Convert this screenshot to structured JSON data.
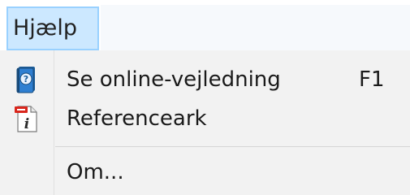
{
  "menubar": {
    "title": "Hjælp"
  },
  "menu": {
    "items": [
      {
        "label": "Se online-vejledning",
        "shortcut": "F1",
        "icon": "help-book-icon"
      },
      {
        "label": "Referenceark",
        "icon": "pdf-info-document-icon"
      },
      {
        "label": "Om..."
      }
    ]
  },
  "colors": {
    "menu_title_bg": "#cce8ff",
    "menu_title_border": "#99d1ff",
    "dropdown_bg": "#f2f2f2"
  }
}
